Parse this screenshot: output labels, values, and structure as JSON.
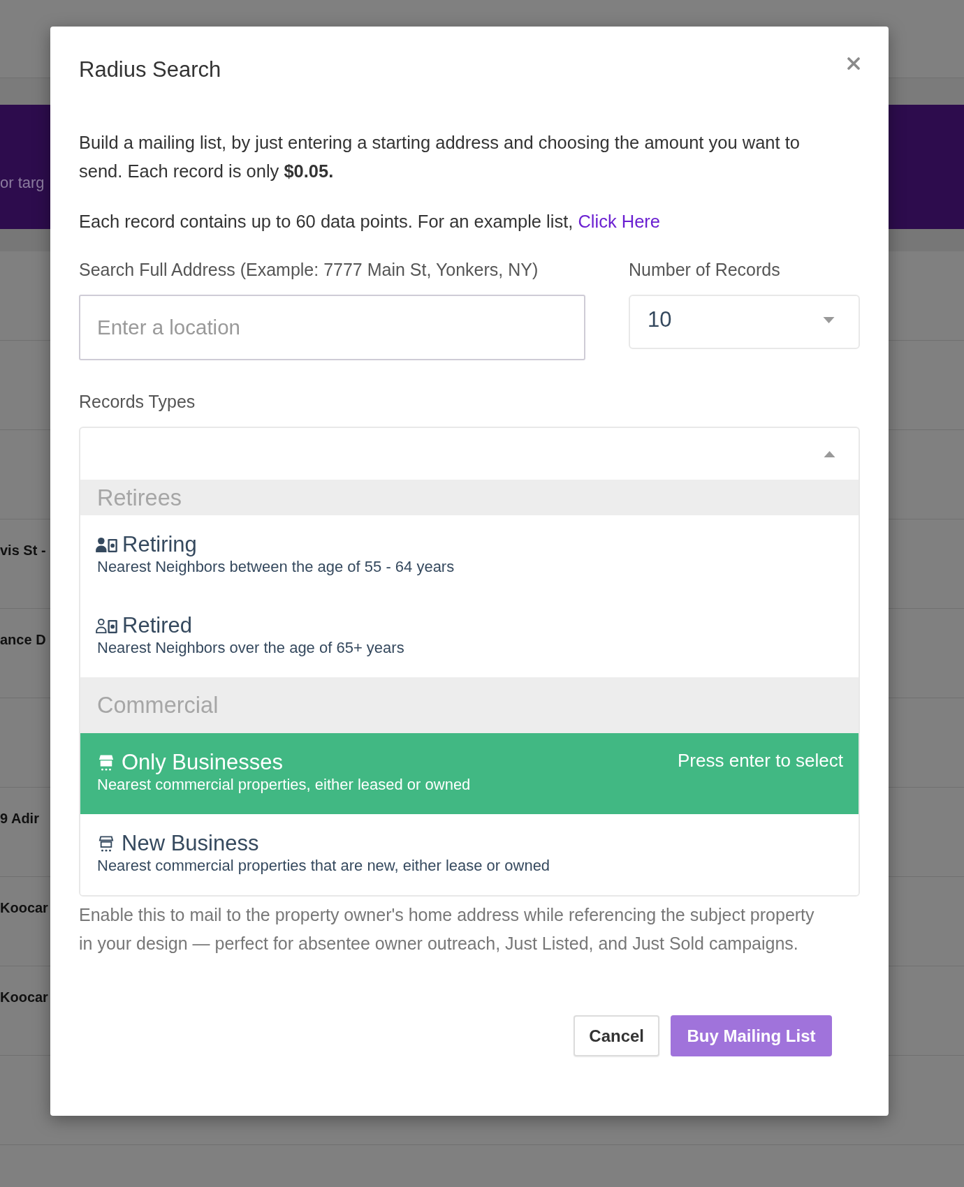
{
  "background_page": {
    "banner": {
      "text": "or targ"
    },
    "rows": [
      {
        "kind": "blank"
      },
      {
        "kind": "blank"
      },
      {
        "kind": "blank"
      },
      {
        "kind": "address",
        "text": "vis St -"
      },
      {
        "kind": "address",
        "text": "ance D"
      },
      {
        "kind": "blank"
      },
      {
        "kind": "address",
        "text": "9 Adir"
      },
      {
        "kind": "address",
        "text": "Koocar"
      },
      {
        "kind": "address",
        "text": "Koocar"
      },
      {
        "kind": "blank"
      }
    ]
  },
  "modal": {
    "title": "Radius Search",
    "intro": "Build a mailing list, by just entering a starting address and choosing the amount you want to send. Each record is only **$0.05.**",
    "example_note": {
      "text": "Each record contains up to 60 data points. For an example list,",
      "link": "Click Here"
    },
    "address_field": {
      "label": "Search Full Address (Example: 7777 Main St, Yonkers, NY)",
      "placeholder": "Enter a location"
    },
    "records_field": {
      "label": "Number of Records",
      "value": "10"
    },
    "record_types": {
      "label": "Records Types",
      "expanded": true,
      "select_hint": "Press enter to select",
      "groups": [
        {
          "label": "Retirees",
          "kind": "people",
          "options": [
            {
              "title": "Retiring",
              "description": "Nearest Neighbors between the age of 55 - 64 years",
              "highlighted": false
            },
            {
              "title": "Retired",
              "description": "Nearest Neighbors over the age of 65+ years",
              "highlighted": false
            }
          ]
        },
        {
          "label": "Commercial",
          "kind": "business",
          "options": [
            {
              "title": "Only Businesses",
              "description": "Nearest commercial properties, either leased or owned",
              "highlighted": true
            },
            {
              "title": "New Business",
              "description": "Nearest commercial properties that are new, either lease or owned",
              "highlighted": false
            }
          ]
        }
      ]
    },
    "footer_note": "Enable this to mail to the property owner's home address while referencing the subject property in your design — perfect for absentee owner outreach, Just Listed, and Just Sold campaigns.",
    "buttons": [
      {
        "label": "Cancel",
        "kind": "secondary"
      },
      {
        "label": "Buy Mailing List",
        "kind": "primary"
      }
    ]
  }
}
